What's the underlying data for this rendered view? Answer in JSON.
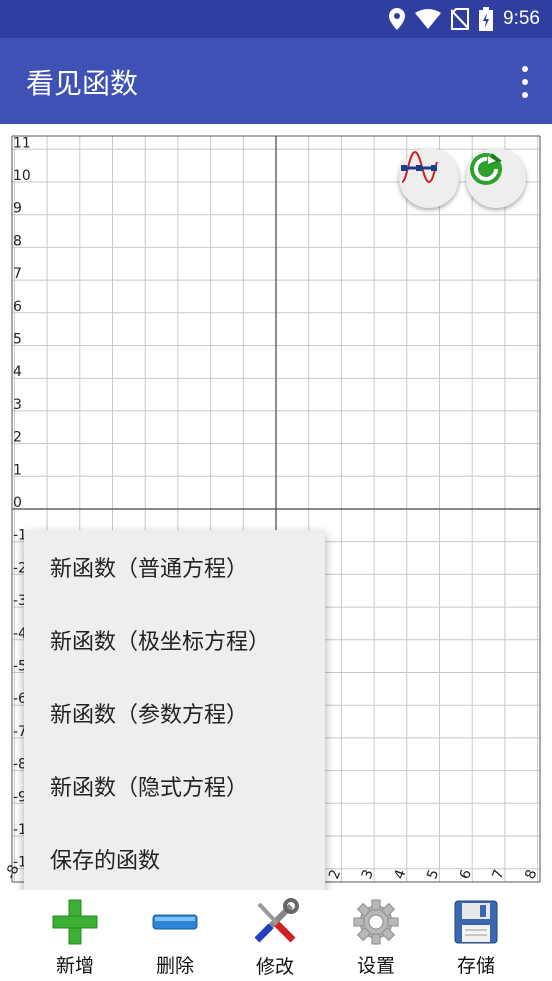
{
  "status_bar": {
    "time": "9:56",
    "icons": [
      "location-icon",
      "wifi-icon",
      "no-sim-icon",
      "battery-charging-icon"
    ]
  },
  "app_bar": {
    "title": "看见函数",
    "menu_icon": "more-vert-icon"
  },
  "graph": {
    "y_tick_labels": [
      "11",
      "10",
      "9",
      "8",
      "7",
      "6",
      "5",
      "4",
      "3",
      "2",
      "1",
      "0",
      "-1",
      "-2",
      "-3",
      "-4",
      "-5",
      "-6",
      "-7",
      "-8",
      "-9",
      "-1",
      "-1"
    ],
    "x_tick_labels": [
      "-8",
      "2",
      "3",
      "4",
      "5",
      "6",
      "7",
      "8"
    ],
    "buttons": {
      "trace": "trace-curve-icon",
      "refresh": "refresh-icon"
    }
  },
  "popup_menu": {
    "items": [
      "新函数（普通方程）",
      "新函数（极坐标方程）",
      "新函数（参数方程）",
      "新函数（隐式方程）",
      "保存的函数"
    ]
  },
  "bottom_toolbar": {
    "add": {
      "label": "新增",
      "icon": "plus-icon"
    },
    "delete": {
      "label": "删除",
      "icon": "minus-icon"
    },
    "edit": {
      "label": "修改",
      "icon": "tools-icon"
    },
    "settings": {
      "label": "设置",
      "icon": "gear-icon"
    },
    "save": {
      "label": "存储",
      "icon": "floppy-disk-icon"
    }
  },
  "colors": {
    "status_bar": "#303F9F",
    "app_bar": "#3F51B5",
    "menu_bg": "#EEEEEE",
    "grid": "#C8C8C8",
    "axis": "#444444"
  }
}
